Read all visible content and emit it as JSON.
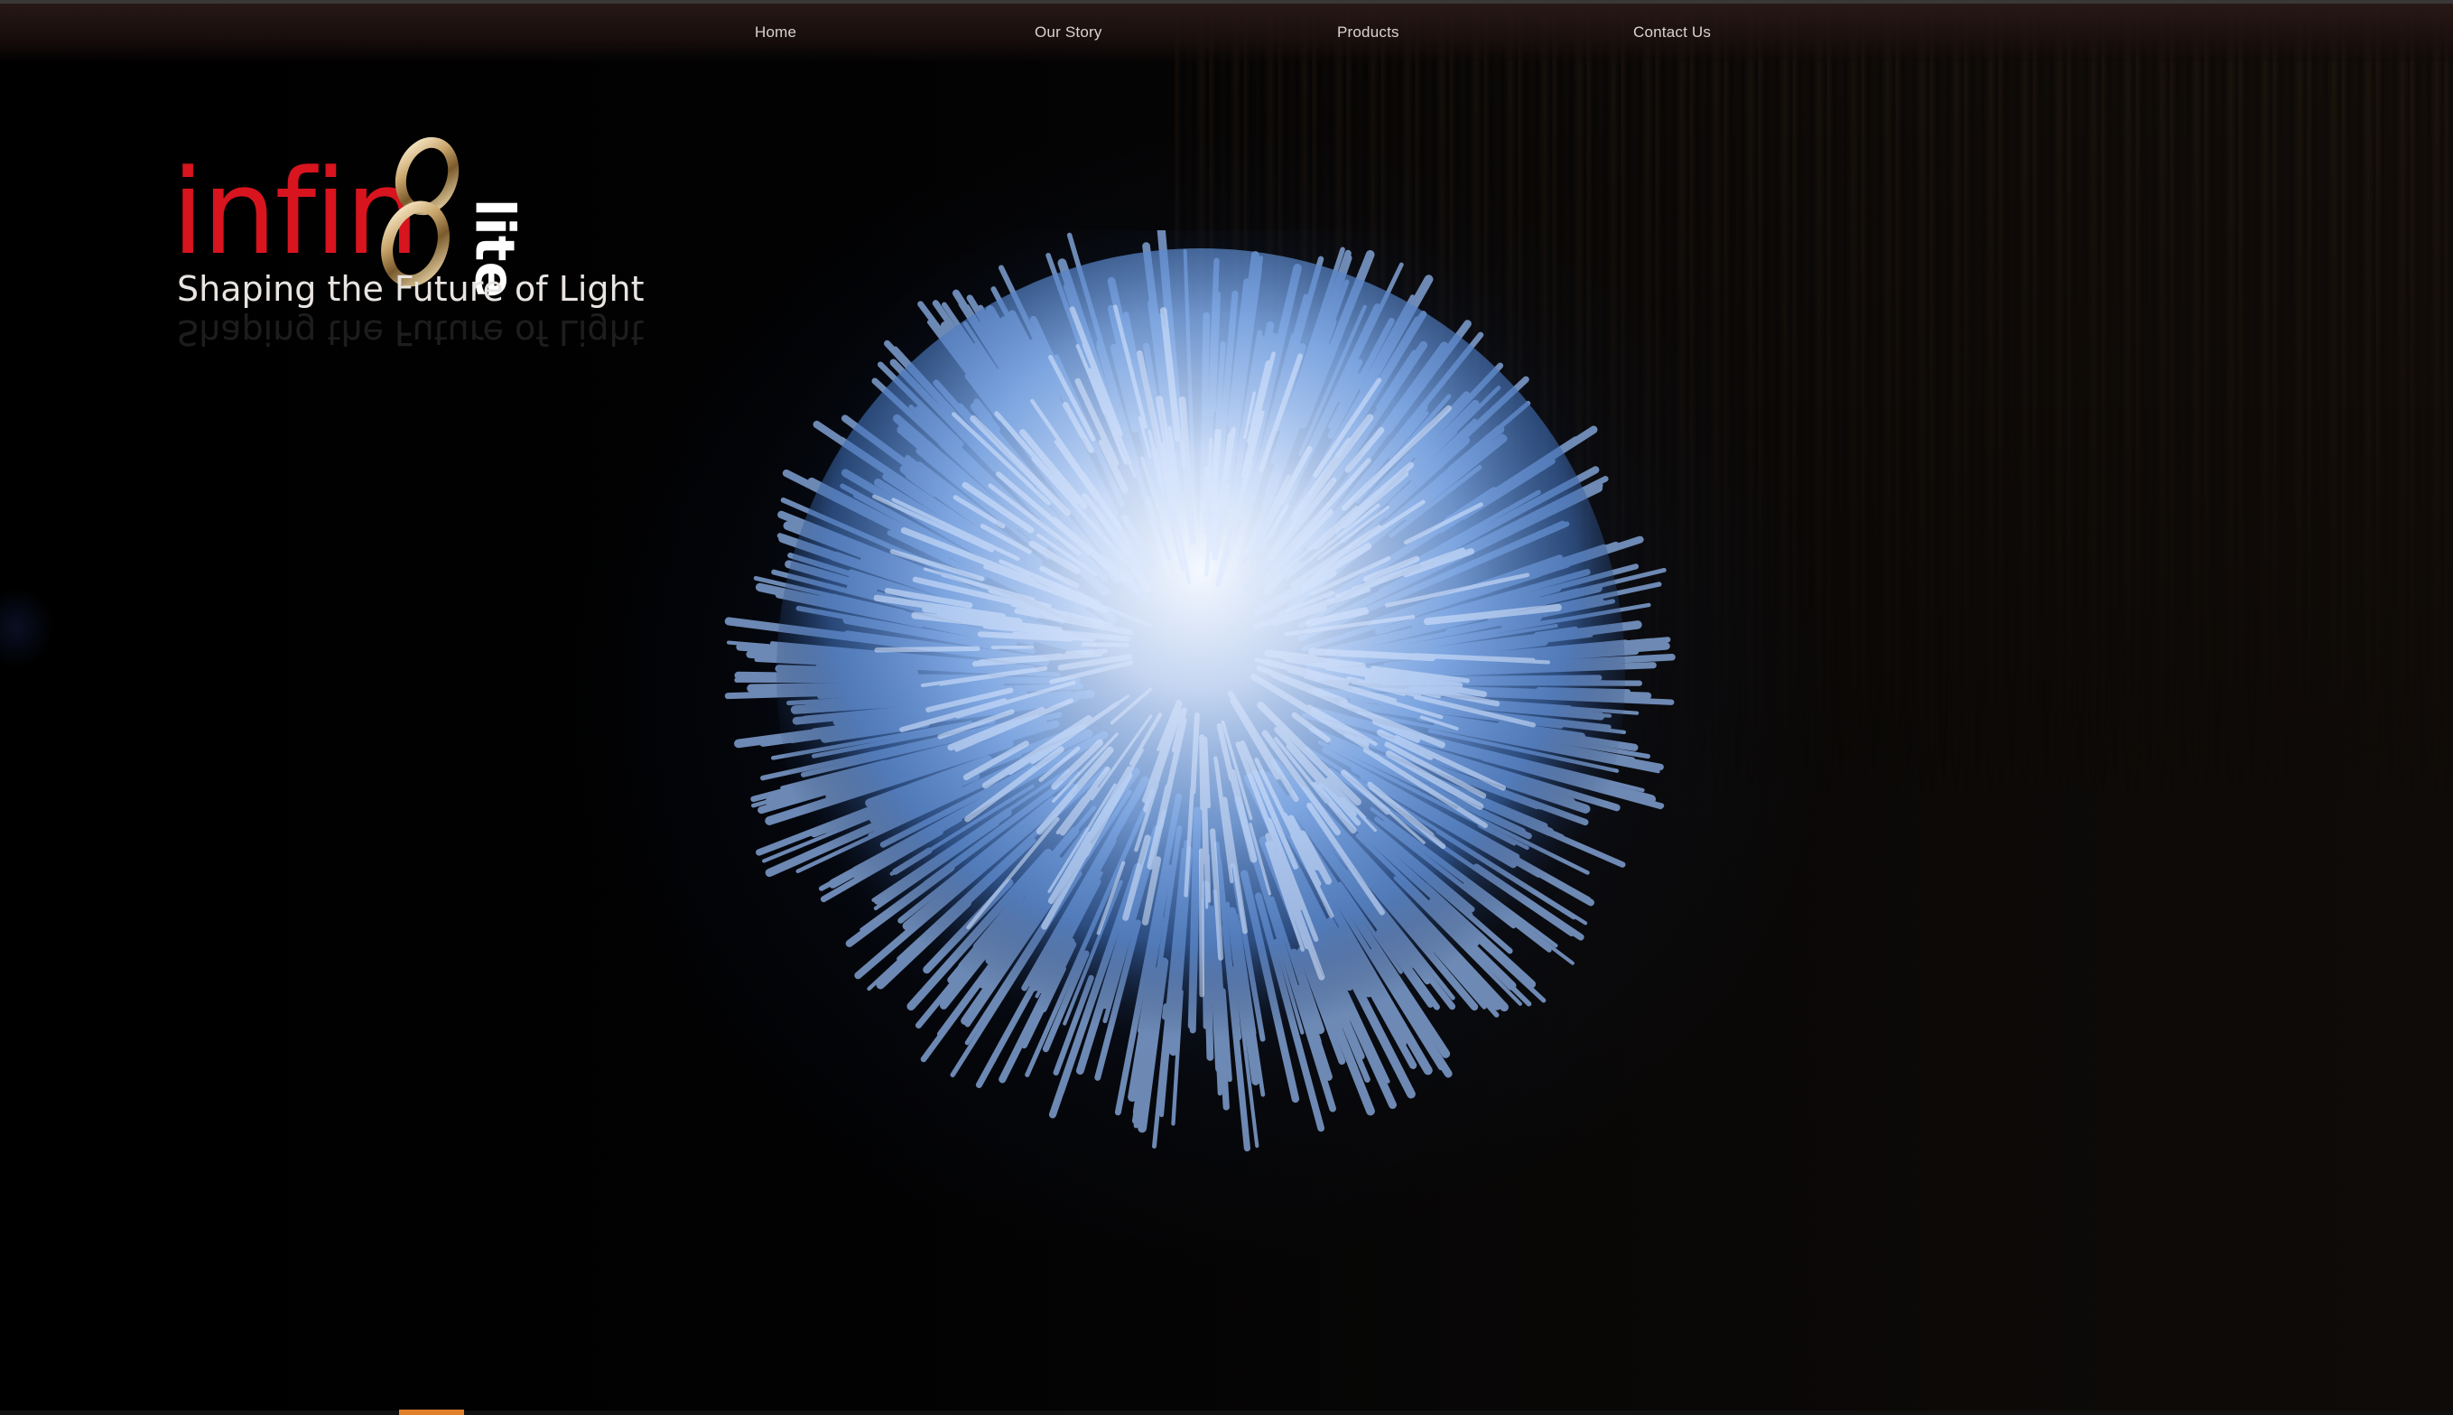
{
  "nav": {
    "items": [
      {
        "label": "Home"
      },
      {
        "label": "Our Story"
      },
      {
        "label": "Products"
      },
      {
        "label": "Contact Us"
      }
    ]
  },
  "logo": {
    "wordmark": "infin",
    "mark": "8",
    "suffix": "lite",
    "tagline": "Shaping the Future of Light"
  },
  "hero": {
    "image": "fiber-optic-light-burst"
  },
  "colors": {
    "brand_red": "#d8141e",
    "accent_orange": "#e0802a",
    "nav_text": "#d9d4cf",
    "background": "#000000"
  }
}
